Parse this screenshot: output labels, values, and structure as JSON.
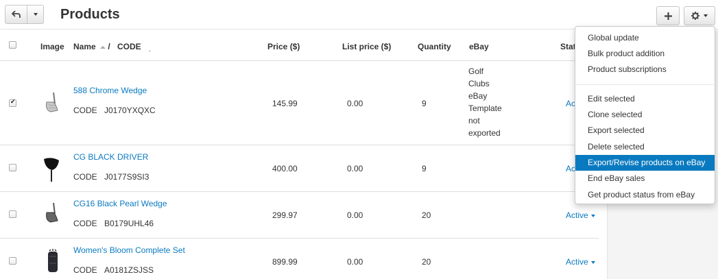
{
  "header": {
    "title": "Products",
    "back_icon": "back-arrow-icon",
    "add_icon": "plus-icon",
    "gear_icon": "gear-icon"
  },
  "table": {
    "columns": {
      "image": "Image",
      "name": "Name",
      "name_sep": "/",
      "code": "CODE",
      "code_dot": ".",
      "price": "Price ($)",
      "list_price": "List price ($)",
      "quantity": "Quantity",
      "ebay": "eBay",
      "status": "Stat"
    },
    "rows": [
      {
        "checked": true,
        "name": "588 Chrome Wedge",
        "code_label": "CODE",
        "code": "J0170YXQXC",
        "price": "145.99",
        "list_price": "0.00",
        "quantity": "9",
        "ebay": [
          "Golf",
          "Clubs",
          "eBay",
          "Template",
          "not",
          "exported"
        ],
        "status": "Activ"
      },
      {
        "checked": false,
        "name": "CG BLACK DRIVER",
        "code_label": "CODE",
        "code": "J0177S9SI3",
        "price": "400.00",
        "list_price": "0.00",
        "quantity": "9",
        "status": "Activ"
      },
      {
        "checked": false,
        "name": "CG16 Black Pearl Wedge",
        "code_label": "CODE",
        "code": "B0179UHL46",
        "price": "299.97",
        "list_price": "0.00",
        "quantity": "20",
        "status": "Active"
      },
      {
        "checked": false,
        "name": "Women's Bloom Complete Set",
        "code_label": "CODE",
        "code": "A0181ZSJSS",
        "price": "899.99",
        "list_price": "0.00",
        "quantity": "20",
        "status": "Active"
      }
    ]
  },
  "menu": {
    "group1": [
      "Global update",
      "Bulk product addition",
      "Product subscriptions"
    ],
    "group2": [
      "Edit selected",
      "Clone selected",
      "Export selected",
      "Delete selected",
      "Export/Revise products on eBay",
      "End eBay sales",
      "Get product status from eBay"
    ],
    "highlighted": "Export/Revise products on eBay"
  },
  "colors": {
    "link": "#0a7ac0",
    "highlight": "#0a7ac0"
  }
}
